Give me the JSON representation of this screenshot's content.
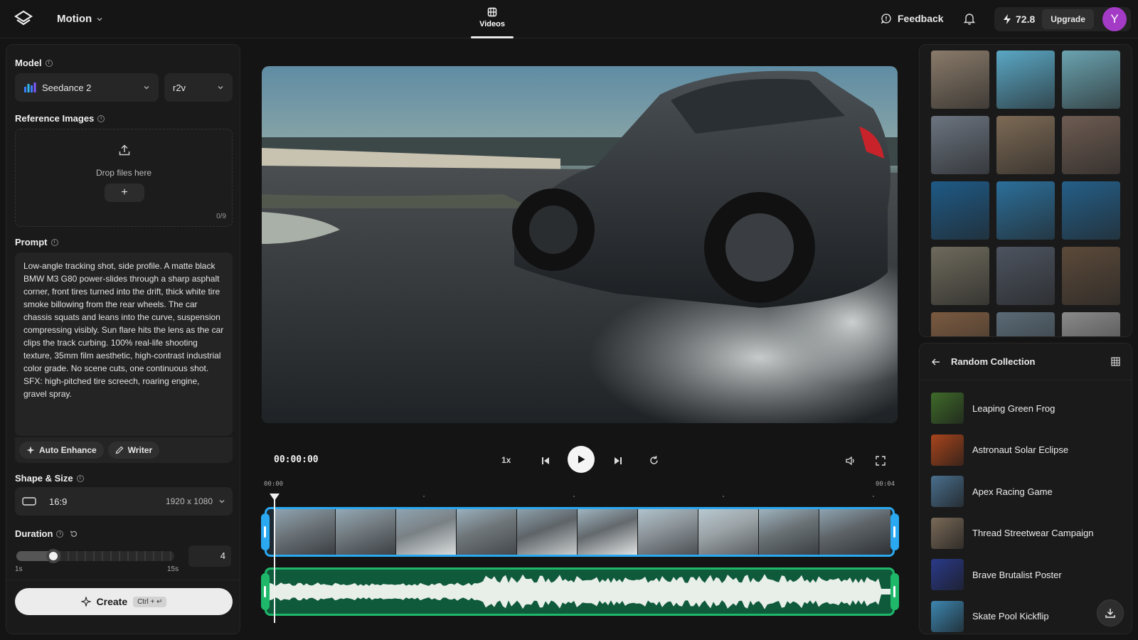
{
  "header": {
    "app_name": "Motion",
    "nav_tab": "Videos",
    "feedback_label": "Feedback",
    "credits": "72.8",
    "upgrade_label": "Upgrade",
    "avatar_initial": "Y"
  },
  "model": {
    "label": "Model",
    "selected": "Seedance 2",
    "mode": "r2v"
  },
  "reference": {
    "label": "Reference Images",
    "drop_text": "Drop files here",
    "add_label": "+",
    "count": "0/9"
  },
  "prompt": {
    "label": "Prompt",
    "text": "Low-angle tracking shot, side profile. A matte black BMW M3 G80 power-slides through a sharp asphalt corner, front tires turned into the drift, thick white tire smoke billowing from the rear wheels. The car chassis squats and leans into the curve, suspension compressing visibly. Sun flare hits the lens as the car clips the track curbing. 100% real-life shooting texture, 35mm film aesthetic, high-contrast industrial color grade. No scene cuts, one continuous shot. SFX: high-pitched tire screech, roaring engine, gravel spray.",
    "auto_enhance_label": "Auto Enhance",
    "writer_label": "Writer"
  },
  "shape": {
    "label": "Shape & Size",
    "ratio": "16:9",
    "resolution": "1920 x 1080"
  },
  "duration": {
    "label": "Duration",
    "min_label": "1s",
    "max_label": "15s",
    "value": "4",
    "min": 1,
    "max": 15
  },
  "create": {
    "label": "Create",
    "shortcut": "Ctrl + ↵"
  },
  "player": {
    "timecode": "00:00:00",
    "speed": "1x",
    "timeline_start": "00:00",
    "timeline_end": "00:04"
  },
  "collection": {
    "title": "Random Collection",
    "items": [
      {
        "label": "Leaping Green Frog",
        "color": "#3f6b2a"
      },
      {
        "label": "Astronaut Solar Eclipse",
        "color": "#a8451c"
      },
      {
        "label": "Apex Racing Game",
        "color": "#4a6f8c"
      },
      {
        "label": "Thread Streetwear Campaign",
        "color": "#7a6a58"
      },
      {
        "label": "Brave Brutalist Poster",
        "color": "#2a3a8a"
      },
      {
        "label": "Skate Pool Kickflip",
        "color": "#3d86b0"
      }
    ]
  },
  "gallery": {
    "thumb_colors": [
      "#8a7b6a",
      "#5aa7c4",
      "#6aa3b0",
      "#6b7480",
      "#7d6a55",
      "#6e5c52",
      "#1e5a86",
      "#2b6f9a",
      "#245f88",
      "#6e6a5c",
      "#4d5460",
      "#5c4a3a",
      "#7a5a40",
      "#5a6a76",
      "#8a8a8a"
    ]
  }
}
